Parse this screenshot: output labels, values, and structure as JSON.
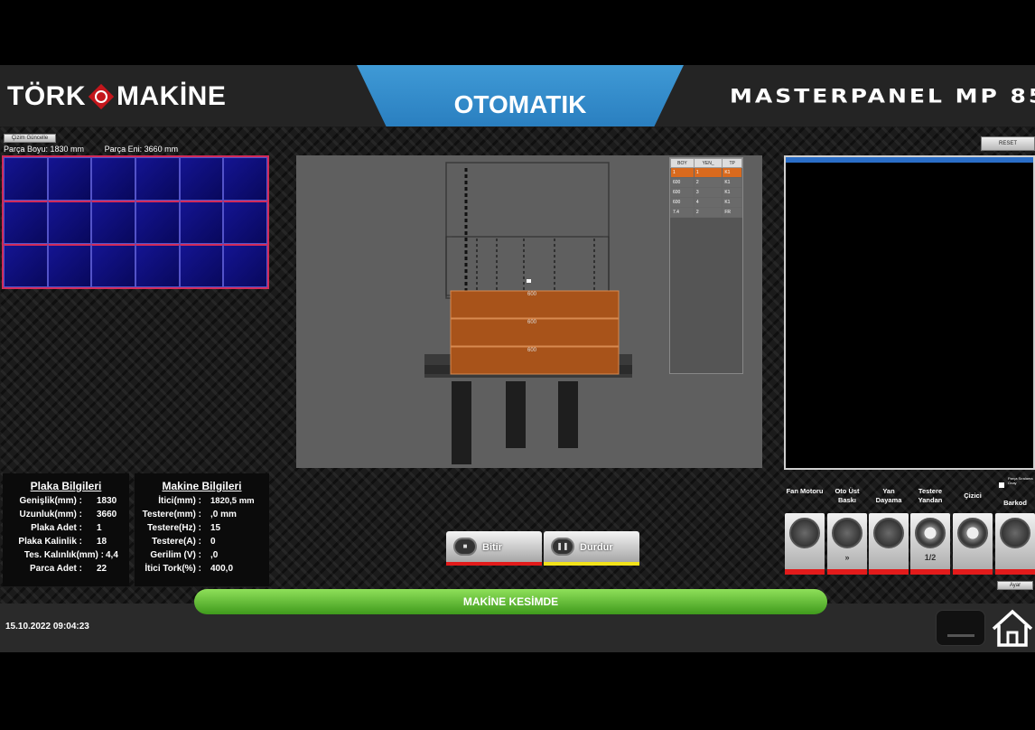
{
  "header": {
    "logo_left": "TÖRK",
    "logo_right": "MAKİNE",
    "mode": "OTOMATIK",
    "brand": "MASTERPANEL MP 85"
  },
  "top_left": {
    "button_label": "Çizim Güncelle",
    "part_length": "Parça Boyu:  1830 mm",
    "part_width": "Parça Eni: 3660 mm"
  },
  "reset_label": "RESET",
  "cut_table": {
    "headers": [
      "BOY",
      "YEN_",
      "TP"
    ],
    "rows": [
      [
        "1",
        "1",
        "K1"
      ],
      [
        "600",
        "2",
        "K1"
      ],
      [
        "600",
        "3",
        "K1"
      ],
      [
        "600",
        "4",
        "K1"
      ],
      [
        "7.4",
        "2",
        "FR"
      ]
    ]
  },
  "viewport": {
    "plank_labels": [
      "600",
      "600",
      "600"
    ]
  },
  "plaka": {
    "title": "Plaka Bilgileri",
    "rows": [
      {
        "label": "Genişlik(mm) :",
        "value": "1830"
      },
      {
        "label": "Uzunluk(mm) :",
        "value": "3660"
      },
      {
        "label": "Plaka Adet :",
        "value": "1"
      },
      {
        "label": "Plaka Kalinlik :",
        "value": "18"
      },
      {
        "label": "Tes. Kalınlık(mm) :",
        "value": "4,4"
      },
      {
        "label": "Parca Adet :",
        "value": "22"
      }
    ]
  },
  "makine": {
    "title": "Makine Bilgileri",
    "rows": [
      {
        "label": "İtici(mm) :",
        "value": "1820,5 mm"
      },
      {
        "label": "Testere(mm) :",
        "value": ",0 mm"
      },
      {
        "label": "Testere(Hz) :",
        "value": "15"
      },
      {
        "label": "Testere(A) :",
        "value": "0"
      },
      {
        "label": "Gerilim (V) :",
        "value": ",0"
      },
      {
        "label": "İtici Tork(%) :",
        "value": "400,0"
      }
    ]
  },
  "controls": {
    "start_label": "Bitir",
    "stop_label": "Durdur",
    "start_strip": "#e21b1b",
    "stop_strip": "#f2e21a"
  },
  "functions": [
    {
      "label": "Fan Motoru",
      "icon": "fan-icon",
      "sub": ""
    },
    {
      "label": "Oto Üst Baskı",
      "icon": "press-icon",
      "sub": "»"
    },
    {
      "label": "Yan Dayama",
      "icon": "side-stop-icon",
      "sub": ""
    },
    {
      "label": "Testere Yandan",
      "icon": "saw-blade-icon",
      "sub": "1/2"
    },
    {
      "label": "Çizici",
      "icon": "scorer-icon",
      "sub": ""
    },
    {
      "label": "Barkod",
      "icon": "barcode-book-icon",
      "sub": ""
    }
  ],
  "checkbox_label": "Parça Sıralama Onay",
  "small_right_button": "Ayar",
  "status": "MAKİNE KESİMDE",
  "datetime": "15.10.2022 09:04:23",
  "colors": {
    "accent_blue": "#2a7fc0",
    "status_green": "#5bb52a",
    "plank_orange": "#a8531a",
    "alert_red": "#e21b1b"
  }
}
